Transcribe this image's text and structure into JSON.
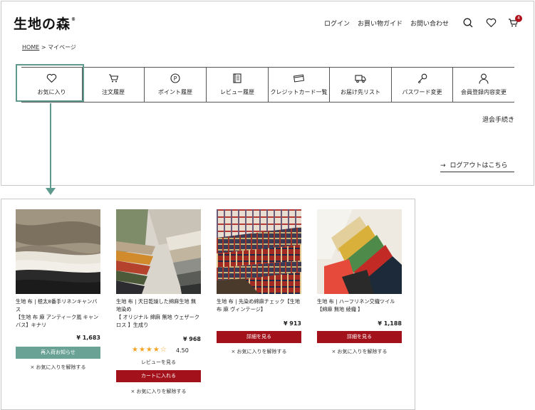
{
  "header": {
    "logo": "生地の森",
    "logo_mark": "®",
    "nav": {
      "login": "ログイン",
      "guide": "お買い物ガイド",
      "contact": "お問い合わせ"
    },
    "cart_count": "4",
    "icons": [
      "search-icon",
      "heart-icon",
      "cart-icon"
    ]
  },
  "breadcrumb": {
    "home": "HOME",
    "sep": " > ",
    "current": "マイページ"
  },
  "menu": [
    {
      "label": "お気に入り",
      "icon": "heart-icon"
    },
    {
      "label": "注文履歴",
      "icon": "cart-icon"
    },
    {
      "label": "ポイント履歴",
      "icon": "point-icon"
    },
    {
      "label": "レビュー履歴",
      "icon": "book-icon"
    },
    {
      "label": "クレジットカード一覧",
      "icon": "credit-card-icon"
    },
    {
      "label": "お届け先リスト",
      "icon": "truck-icon"
    },
    {
      "label": "パスワード変更",
      "icon": "key-icon"
    },
    {
      "label": "会員登録内容変更",
      "icon": "user-icon"
    }
  ],
  "withdraw": "退会手続き",
  "logout": {
    "arrow": "→",
    "label": "ログアウトはこちら"
  },
  "products": [
    {
      "title": "生地 布 | 極太8番手リネンキャンバス\n【生地 布 麻 アンティーク風 キャンバス】キナリ",
      "price": "¥ 1,683",
      "button": "再入荷お知らせ",
      "unfav": "× お気に入りを解除する"
    },
    {
      "title": "生地 布 | 天日乾燥した綿麻生地 無地染め\n【 オリジナル 綿麻 無地 ウェザークロス 】生成り",
      "price": "¥ 968",
      "stars": "★★★★☆",
      "rating": "4.50",
      "review_link": "レビューを見る",
      "button": "カートに入れる",
      "unfav": "× お気に入りを解除する"
    },
    {
      "title": "生地 布 | 先染め綿麻チェック【生地 布 麻 ヴィンテージ】",
      "price": "¥ 913",
      "button": "詳細を見る",
      "unfav": "× お気に入りを解除する"
    },
    {
      "title": "生地 布 | ハーフリネン交織ツイル【綿麻 無地 綾織 】",
      "price": "¥ 1,188",
      "button": "詳細を見る",
      "unfav": "× お気に入りを解除する"
    }
  ],
  "colors": {
    "accent": "#5e9a8e",
    "button_red": "#a3111b",
    "button_green": "#6aa395",
    "star": "#f2a323",
    "badge": "#b0121b"
  }
}
